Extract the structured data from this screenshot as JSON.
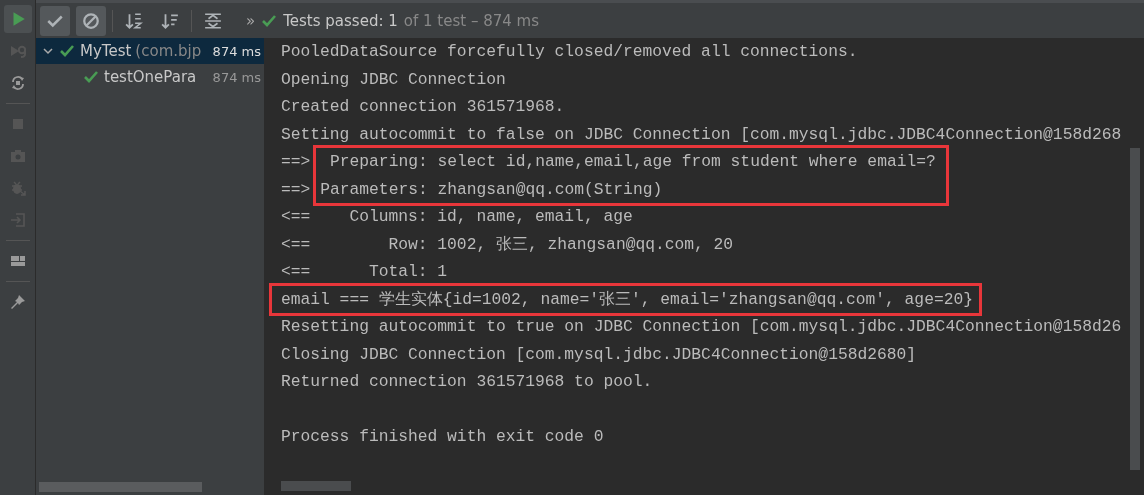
{
  "side_strip": [
    {
      "kind": "run",
      "disabled": false
    },
    {
      "kind": "rerun",
      "disabled": true
    },
    {
      "kind": "auto",
      "disabled": false
    },
    {
      "kind": "stop",
      "disabled": true
    },
    {
      "kind": "camera",
      "disabled": true
    },
    {
      "kind": "bug",
      "disabled": true
    },
    {
      "kind": "import",
      "disabled": true
    },
    {
      "kind": "layout",
      "disabled": false
    },
    {
      "kind": "pin",
      "disabled": false
    }
  ],
  "toolbar": {
    "buttons": [
      {
        "kind": "check",
        "selected": true
      },
      {
        "kind": "ignored",
        "selected": true
      },
      {
        "kind": "sort-alpha",
        "selected": false
      },
      {
        "kind": "sort-duration",
        "selected": false
      },
      {
        "kind": "expand",
        "selected": false
      }
    ],
    "more": "»",
    "status": {
      "passed": "Tests passed: 1",
      "detail": "of 1 test – 874 ms"
    }
  },
  "tree": {
    "items": [
      {
        "name": "MyTest",
        "package": "(com.bjp",
        "time": "874 ms",
        "passed": true,
        "selected": true,
        "expanded": true,
        "children": [
          {
            "name": "testOnePara",
            "time": "874 ms",
            "passed": true,
            "selected": false
          }
        ]
      }
    ]
  },
  "console": {
    "blocks": [
      {
        "kind": "line",
        "text": "PooledDataSource forcefully closed/removed all connections."
      },
      {
        "kind": "line",
        "text": "Opening JDBC Connection"
      },
      {
        "kind": "line",
        "text": "Created connection 361571968."
      },
      {
        "kind": "line",
        "text": "Setting autocommit to false on JDBC Connection [com.mysql.jdbc.JDBC4Connection@158d268"
      },
      {
        "kind": "highlight",
        "lines": [
          {
            "prefix": "==>",
            "text": " Preparing: select id,name,email,age from student where email=?"
          },
          {
            "prefix": "==>",
            "text": "Parameters: zhangsan@qq.com(String)"
          }
        ]
      },
      {
        "kind": "line",
        "text": "<==    Columns: id, name, email, age"
      },
      {
        "kind": "line",
        "text": "<==        Row: 1002, 张三, zhangsan@qq.com, 20"
      },
      {
        "kind": "line",
        "text": "<==      Total: 1"
      },
      {
        "kind": "highlight",
        "lines": [
          {
            "text": "email === 学生实体{id=1002, name='张三', email='zhangsan@qq.com', age=20}"
          }
        ]
      },
      {
        "kind": "line",
        "text": "Resetting autocommit to true on JDBC Connection [com.mysql.jdbc.JDBC4Connection@158d26"
      },
      {
        "kind": "line",
        "text": "Closing JDBC Connection [com.mysql.jdbc.JDBC4Connection@158d2680]"
      },
      {
        "kind": "line",
        "text": "Returned connection 361571968 to pool."
      },
      {
        "kind": "blank"
      },
      {
        "kind": "line",
        "text": "Process finished with exit code 0"
      }
    ]
  }
}
